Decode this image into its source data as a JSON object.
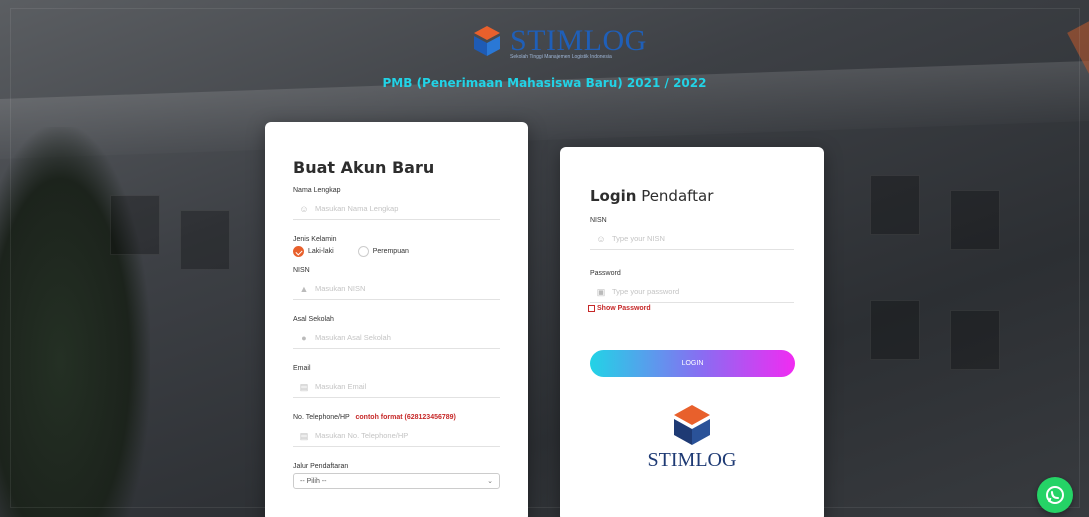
{
  "header": {
    "brand_name": "STIMLOG",
    "brand_sub": "Sekolah Tinggi Manajemen Logistik Indonesia",
    "headline": "PMB (Penerimaan Mahasiswa Baru) 2021 / 2022"
  },
  "register": {
    "title": "Buat Akun Baru",
    "nama_label": "Nama Lengkap",
    "nama_placeholder": "Masukan Nama Lengkap",
    "gender_label": "Jenis Kelamin",
    "gender_options": [
      "Laki-laki",
      "Perempuan"
    ],
    "gender_selected": "Laki-laki",
    "nisn_label": "NISN",
    "nisn_placeholder": "Masukan NISN",
    "sekolah_label": "Asal Sekolah",
    "sekolah_placeholder": "Masukan Asal Sekolah",
    "email_label": "Email",
    "email_placeholder": "Masukan Email",
    "phone_label": "No. Telephone/HP",
    "phone_hint": "contoh format (628123456789)",
    "phone_placeholder": "Masukan No. Telephone/HP",
    "jalur_label": "Jalur Pendaftaran",
    "jalur_selected": "-- Pilih --"
  },
  "login": {
    "title_bold": "Login",
    "title_rest": " Pendaftar",
    "nisn_label": "NISN",
    "nisn_placeholder": "Type your NISN",
    "password_label": "Password",
    "password_placeholder": "Type your password",
    "show_password": "Show Password",
    "button": "LOGIN",
    "logo_text": "STIMLOG"
  },
  "colors": {
    "accent_cyan": "#22d3e6",
    "accent_magenta": "#f12bf2",
    "brand_orange": "#e8602c",
    "brand_blue": "#1e3a74",
    "whatsapp": "#25d366"
  },
  "icons": [
    "user-icon",
    "person-icon",
    "circle-icon",
    "id-card-icon",
    "lock-icon",
    "whatsapp-icon",
    "chevron-down-icon"
  ]
}
